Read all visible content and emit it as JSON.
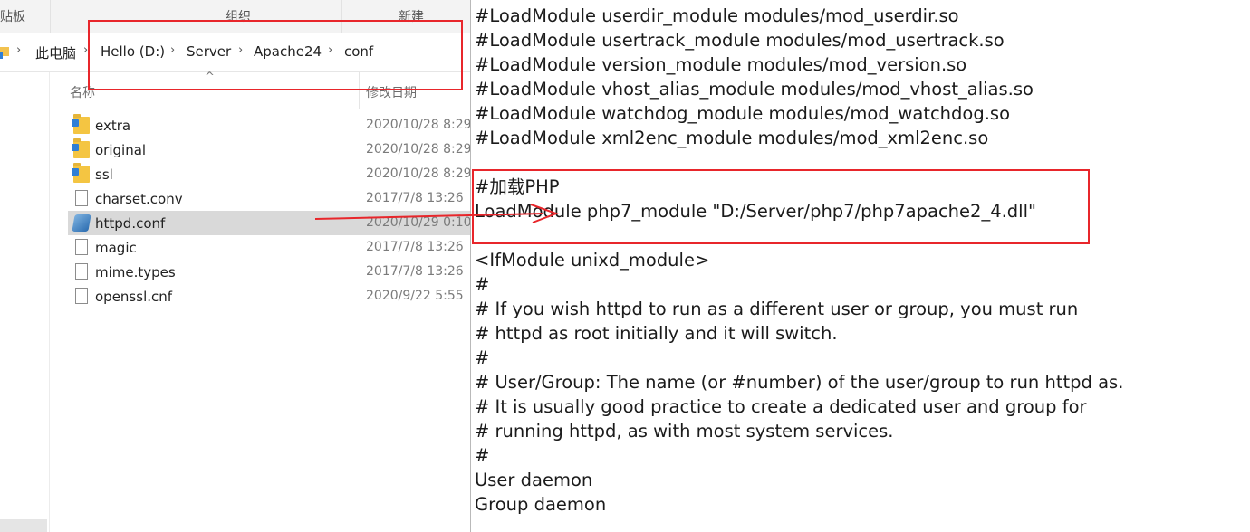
{
  "ribbon": {
    "clipboard_label": "贴板",
    "organize_label": "组织",
    "new_label": "新建"
  },
  "breadcrumb": {
    "items": [
      "此电脑",
      "Hello (D:)",
      "Server",
      "Apache24",
      "conf"
    ]
  },
  "file_list": {
    "columns": {
      "name": "名称",
      "modified": "修改日期"
    },
    "sort_indicator": "^",
    "files": [
      {
        "name": "extra",
        "date": "2020/10/28 8:29",
        "type": "folder"
      },
      {
        "name": "original",
        "date": "2020/10/28 8:29",
        "type": "folder"
      },
      {
        "name": "ssl",
        "date": "2020/10/28 8:29",
        "type": "folder"
      },
      {
        "name": "charset.conv",
        "date": "2017/7/8 13:26",
        "type": "file"
      },
      {
        "name": "httpd.conf",
        "date": "2020/10/29 0:10",
        "type": "conf",
        "selected": true
      },
      {
        "name": "magic",
        "date": "2017/7/8 13:26",
        "type": "file"
      },
      {
        "name": "mime.types",
        "date": "2017/7/8 13:26",
        "type": "file"
      },
      {
        "name": "openssl.cnf",
        "date": "2020/9/22 5:55",
        "type": "file"
      }
    ]
  },
  "editor": {
    "lines": [
      "#LoadModule userdir_module modules/mod_userdir.so",
      "#LoadModule usertrack_module modules/mod_usertrack.so",
      "#LoadModule version_module modules/mod_version.so",
      "#LoadModule vhost_alias_module modules/mod_vhost_alias.so",
      "#LoadModule watchdog_module modules/mod_watchdog.so",
      "#LoadModule xml2enc_module modules/mod_xml2enc.so",
      "",
      "#加载PHP",
      "LoadModule php7_module \"D:/Server/php7/php7apache2_4.dll\"",
      "",
      "<IfModule unixd_module>",
      "#",
      "# If you wish httpd to run as a different user or group, you must run",
      "# httpd as root initially and it will switch.",
      "#",
      "# User/Group: The name (or #number) of the user/group to run httpd as.",
      "# It is usually good practice to create a dedicated user and group for",
      "# running httpd, as with most system services.",
      "#",
      "User daemon",
      "Group daemon"
    ]
  },
  "colors": {
    "annotation_red": "#e8262b",
    "selected_row": "#d9d9d9"
  }
}
